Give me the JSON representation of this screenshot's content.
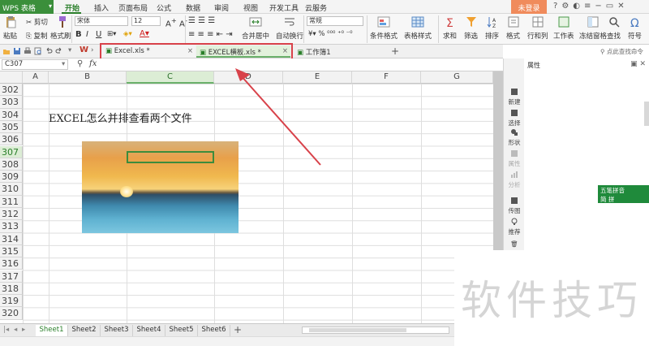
{
  "app": {
    "name": "WPS 表格",
    "login_label": "未登录"
  },
  "menu": {
    "items": [
      "开始",
      "插入",
      "页面布局",
      "公式",
      "数据",
      "审阅",
      "视图",
      "开发工具",
      "云服务"
    ],
    "active": "开始"
  },
  "ribbon": {
    "clipboard": {
      "paste": "粘贴",
      "cut": "剪切",
      "copy": "复制",
      "format_painter": "格式刷"
    },
    "font": {
      "name": "宋体",
      "size": "12"
    },
    "merge": "合并居中",
    "wrap": "自动换行",
    "number_format": "常规",
    "conditional": "条件格式",
    "table_style": "表格样式",
    "sum": "求和",
    "filter": "筛选",
    "sort": "排序",
    "format": "格式",
    "rows_cols": "行和列",
    "worksheet": "工作表",
    "freeze": "冻结窗格",
    "find": "查找",
    "symbol": "符号"
  },
  "doc_tabs": [
    {
      "label": "Excel.xls *",
      "active": false
    },
    {
      "label": "EXCEL横板.xls *",
      "active": true
    },
    {
      "label": "工作簿1",
      "active": false
    }
  ],
  "formula_bar": {
    "name_box": "C307",
    "fx": "fx"
  },
  "columns": [
    "A",
    "B",
    "C",
    "D",
    "E",
    "F",
    "G"
  ],
  "selected_column": "C",
  "rows": [
    "302",
    "303",
    "304",
    "305",
    "306",
    "307",
    "308",
    "309",
    "310",
    "311",
    "312",
    "313",
    "314",
    "315",
    "316",
    "317",
    "318",
    "319",
    "320"
  ],
  "selected_row": "307",
  "cell_text": "EXCEL怎么并排查看两个文件",
  "sheets": [
    "Sheet1",
    "Sheet2",
    "Sheet3",
    "Sheet4",
    "Sheet5",
    "Sheet6"
  ],
  "active_sheet": "Sheet1",
  "side_panel": {
    "buttons": [
      "新建",
      "选择",
      "形状",
      "属性",
      "分析",
      "传图",
      "推荐"
    ],
    "title": "属性",
    "search_hint": "点此查找命令"
  },
  "ime": {
    "line1": "五笔拼音",
    "line2": "简 拼"
  },
  "watermark": "软件技巧",
  "colors": {
    "accent": "#2a7f2a",
    "annotation": "#d8424a",
    "login": "#f08b5c"
  }
}
